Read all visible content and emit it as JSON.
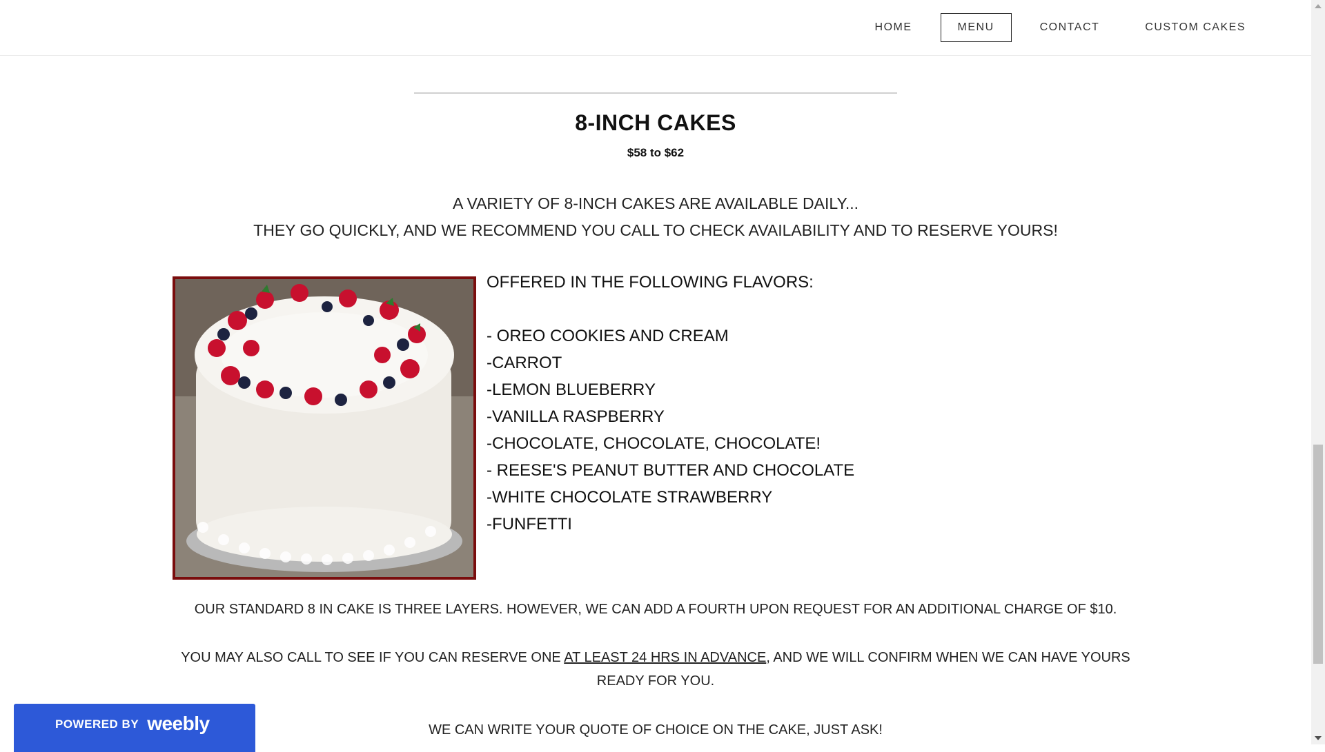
{
  "nav": {
    "items": [
      {
        "label": "HOME"
      },
      {
        "label": "MENU"
      },
      {
        "label": "CONTACT"
      },
      {
        "label": "CUSTOM CAKES"
      }
    ],
    "active_index": 1
  },
  "section": {
    "title": "8-INCH CAKES",
    "price": "$58 to $62",
    "intro_line1": "A VARIETY OF 8-INCH CAKES ARE AVAILABLE DAILY...",
    "intro_line2": "THEY GO QUICKLY, AND WE RECOMMEND YOU CALL TO CHECK AVAILABILITY AND TO RESERVE YOURS!"
  },
  "flavors": {
    "heading": "OFFERED IN THE FOLLOWING FLAVORS:",
    "items": [
      "- OREO COOKIES AND CREAM",
      "-CARROT",
      "-LEMON BLUEBERRY",
      "-VANILLA RASPBERRY",
      "-CHOCOLATE, CHOCOLATE, CHOCOLATE!",
      "- REESE'S PEANUT BUTTER AND CHOCOLATE",
      "-WHITE CHOCOLATE STRAWBERRY",
      "-FUNFETTI"
    ]
  },
  "notes": {
    "layers": "OUR STANDARD 8 IN CAKE IS THREE LAYERS. HOWEVER, WE CAN ADD A FOURTH UPON REQUEST FOR AN ADDITIONAL CHARGE OF $10.",
    "reserve_before": "YOU MAY ALSO CALL TO SEE IF YOU CAN RESERVE ONE ",
    "reserve_link": "AT LEAST 24 HRS IN ADVANCE",
    "reserve_after": ", AND WE WILL CONFIRM WHEN WE CAN HAVE YOURS READY FOR YOU.",
    "quote": "WE CAN WRITE YOUR QUOTE OF CHOICE ON THE CAKE, JUST ASK!"
  },
  "badge": {
    "powered_by": "POWERED BY",
    "brand": "weebly"
  },
  "colors": {
    "badge_bg": "#2d59d8",
    "photo_border": "#7a0d0d"
  }
}
